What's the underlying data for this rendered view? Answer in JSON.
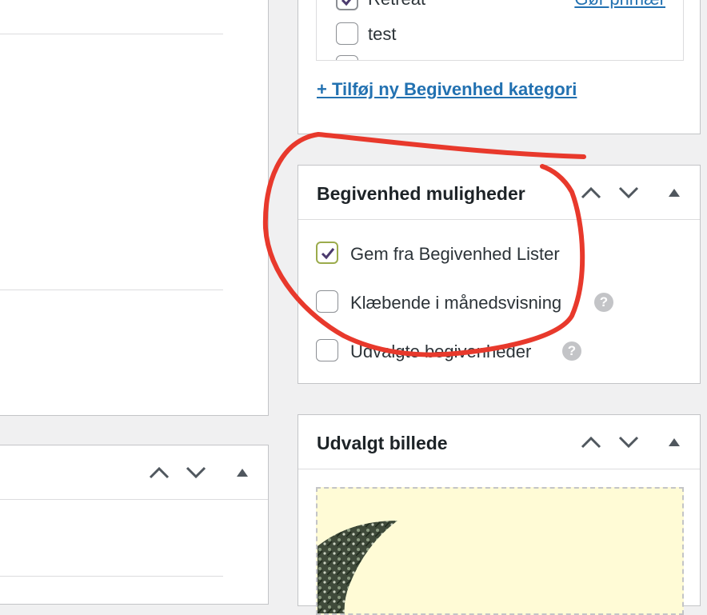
{
  "categories_panel": {
    "items": [
      {
        "label": "Retreat",
        "checked": true
      },
      {
        "label": "test",
        "checked": false
      }
    ],
    "make_primary_link": "Gør primær",
    "add_category_link": "+ Tilføj ny Begivenhed kategori"
  },
  "event_options_panel": {
    "title": "Begivenhed muligheder",
    "options": [
      {
        "label": "Gem fra Begivenhed Lister",
        "checked": true,
        "help": false
      },
      {
        "label": "Klæbende i månedsvisning",
        "checked": false,
        "help": true
      },
      {
        "label": "Udvalgte begivenheder",
        "checked": false,
        "help": true
      }
    ],
    "help_glyph": "?"
  },
  "featured_image_panel": {
    "title": "Udvalgt billede",
    "placeholder_bg": "#fffbd6"
  },
  "annotation": {
    "color": "#e8392c",
    "shape": "hand-drawn-circle"
  }
}
